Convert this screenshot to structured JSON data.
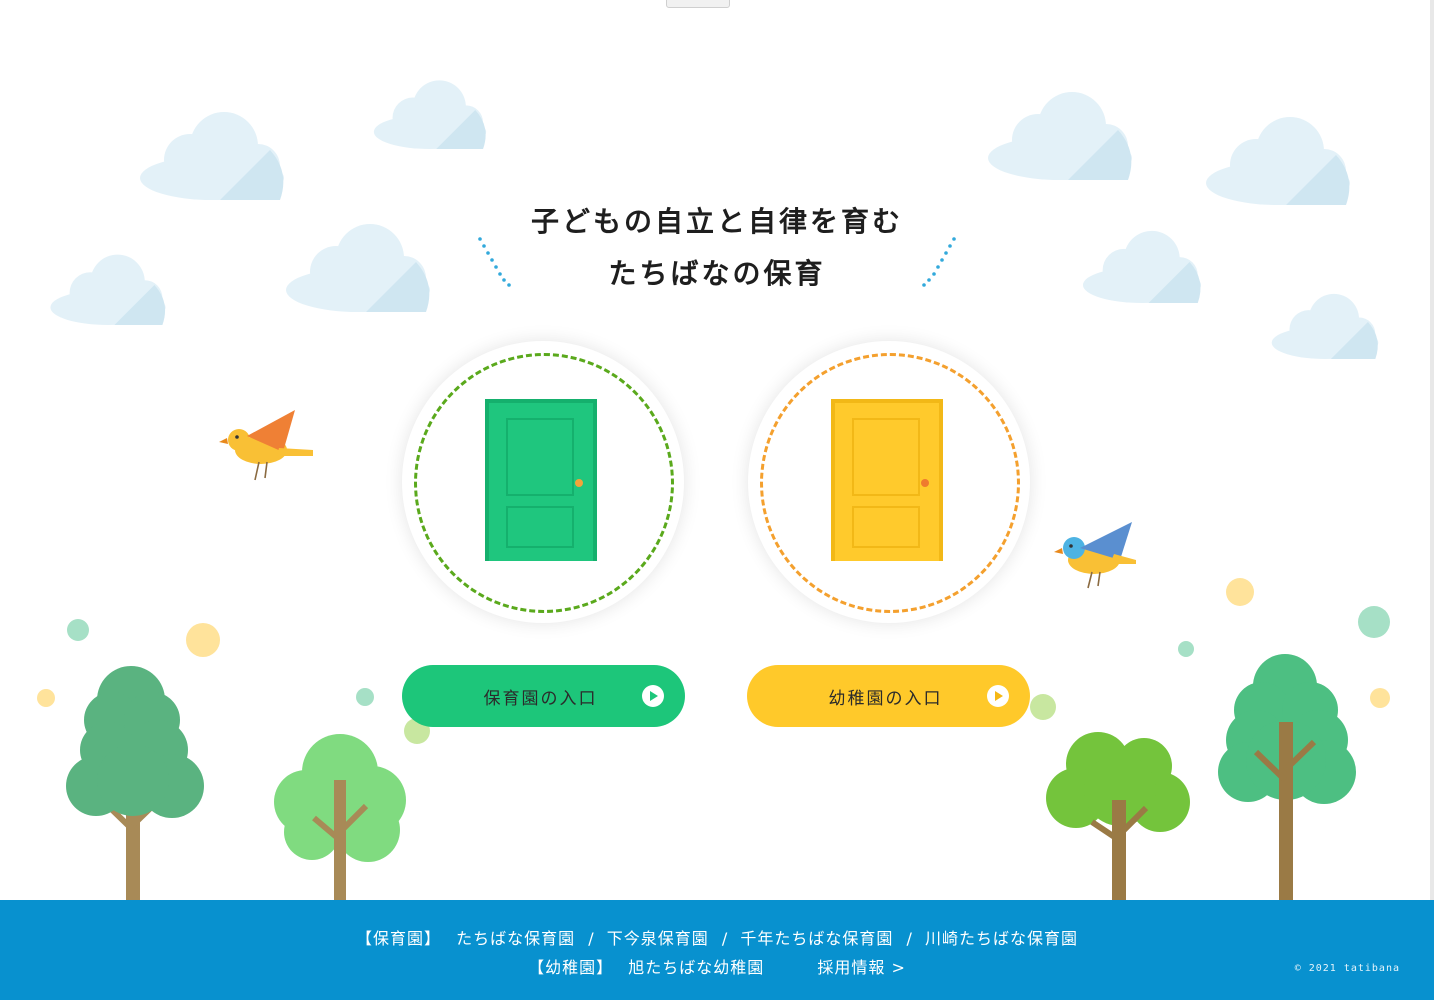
{
  "hero": {
    "title_line1": "子どもの自立と自律を育む",
    "title_line2": "たちばなの保育"
  },
  "entrances": [
    {
      "label": "保育園の入口",
      "color": "#1dc67a",
      "door_color": "#1fc67e",
      "icon": "play-circle-icon"
    },
    {
      "label": "幼稚園の入口",
      "color": "#ffc92a",
      "door_color": "#ffca2c",
      "icon": "play-circle-icon"
    }
  ],
  "footer": {
    "nursery_category": "【保育園】",
    "nursery_links": [
      "たちばな保育園",
      "下今泉保育園",
      "千年たちばな保育園",
      "川崎たちばな保育園"
    ],
    "separator": "/",
    "kindergarten_category": "【幼稚園】",
    "kindergarten_links": [
      "旭たちばな幼稚園"
    ],
    "recruit_label": "採用情報 >",
    "copyright": "© 2021 tatibana",
    "background": "#0891cf"
  },
  "decor": {
    "cloud_color": "#e3f1f8",
    "trees": [
      "tree-icon",
      "tree-icon",
      "tree-icon",
      "tree-icon"
    ],
    "birds": [
      "orange-bird-icon",
      "blue-bird-icon"
    ]
  }
}
